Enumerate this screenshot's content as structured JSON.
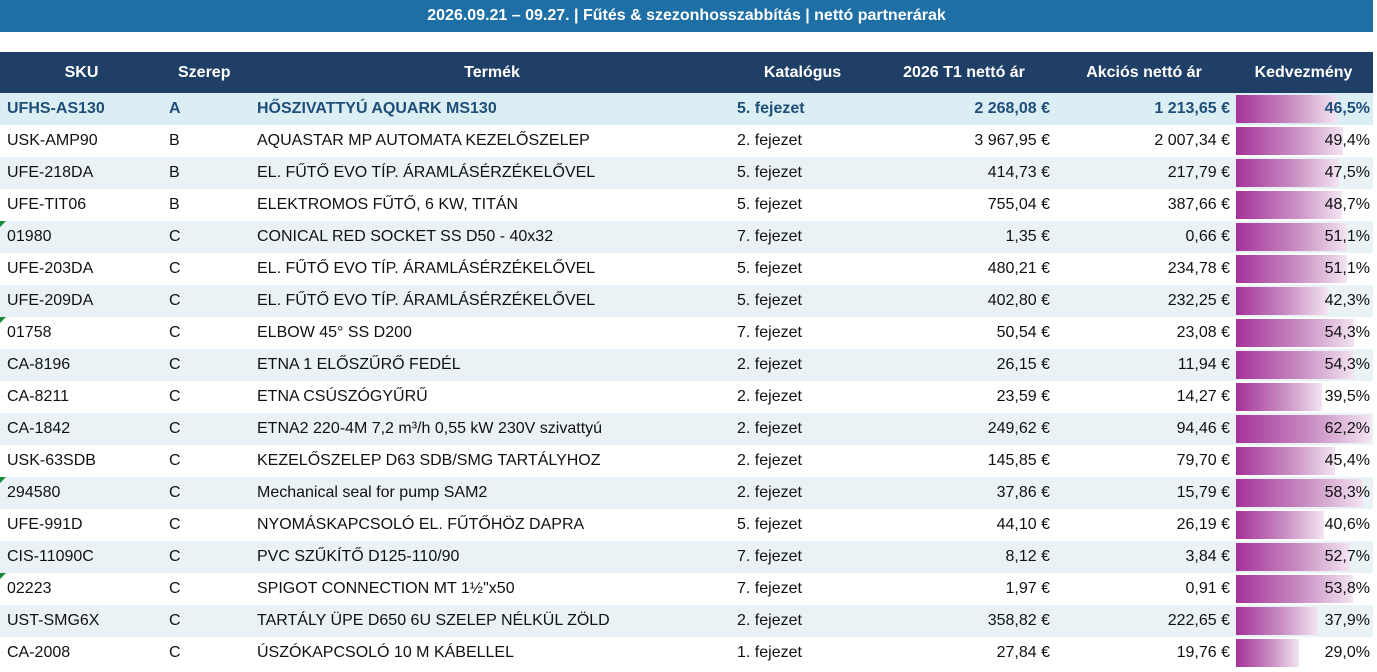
{
  "banner": {
    "text": "2026.09.21 – 09.27.  |  Fűtés & szezonhosszabbítás  |  nettó partnerárak"
  },
  "columns": {
    "sku": "SKU",
    "role": "Szerep",
    "product": "Termék",
    "catalog": "Katalógus",
    "list_price": "2026 T1 nettó ár",
    "promo_price": "Akciós nettó ár",
    "discount": "Kedvezmény"
  },
  "colors": {
    "banner_bg": "#1d6fa5",
    "header_bg": "#1f3f67",
    "highlight_text": "#1f4e79",
    "databar": "#a5329a",
    "comment_marker": "#1a8a3a"
  },
  "rows": [
    {
      "sku": "UFHS-AS130",
      "role": "A",
      "product": "HŐSZIVATTYÚ AQUARK MS130",
      "catalog": "5. fejezet",
      "list": "2 268,08 €",
      "promo": "1 213,65 €",
      "disc": "46,5%",
      "disc_value": 46.5,
      "marker": false
    },
    {
      "sku": "USK-AMP90",
      "role": "B",
      "product": "AQUASTAR MP AUTOMATA KEZELŐSZELEP",
      "catalog": "2. fejezet",
      "list": "3 967,95 €",
      "promo": "2 007,34 €",
      "disc": "49,4%",
      "disc_value": 49.4,
      "marker": false
    },
    {
      "sku": "UFE-218DA",
      "role": "B",
      "product": "EL. FŰTŐ EVO TÍP. ÁRAMLÁSÉRZÉKELŐVEL",
      "catalog": "5. fejezet",
      "list": "414,73 €",
      "promo": "217,79 €",
      "disc": "47,5%",
      "disc_value": 47.5,
      "marker": false
    },
    {
      "sku": "UFE-TIT06",
      "role": "B",
      "product": "ELEKTROMOS FŰTŐ, 6 KW, TITÁN",
      "catalog": "5. fejezet",
      "list": "755,04 €",
      "promo": "387,66 €",
      "disc": "48,7%",
      "disc_value": 48.7,
      "marker": false
    },
    {
      "sku": "01980",
      "role": "C",
      "product": "CONICAL RED SOCKET SS D50 - 40x32",
      "catalog": "7. fejezet",
      "list": "1,35 €",
      "promo": "0,66 €",
      "disc": "51,1%",
      "disc_value": 51.1,
      "marker": true
    },
    {
      "sku": "UFE-203DA",
      "role": "C",
      "product": "EL. FŰTŐ EVO TÍP. ÁRAMLÁSÉRZÉKELŐVEL",
      "catalog": "5. fejezet",
      "list": "480,21 €",
      "promo": "234,78 €",
      "disc": "51,1%",
      "disc_value": 51.1,
      "marker": false
    },
    {
      "sku": "UFE-209DA",
      "role": "C",
      "product": "EL. FŰTŐ EVO TÍP. ÁRAMLÁSÉRZÉKELŐVEL",
      "catalog": "5. fejezet",
      "list": "402,80 €",
      "promo": "232,25 €",
      "disc": "42,3%",
      "disc_value": 42.3,
      "marker": false
    },
    {
      "sku": "01758",
      "role": "C",
      "product": "ELBOW 45° SS D200",
      "catalog": "7. fejezet",
      "list": "50,54 €",
      "promo": "23,08 €",
      "disc": "54,3%",
      "disc_value": 54.3,
      "marker": true
    },
    {
      "sku": "CA-8196",
      "role": "C",
      "product": "ETNA 1 ELŐSZŰRŐ FEDÉL",
      "catalog": "2. fejezet",
      "list": "26,15 €",
      "promo": "11,94 €",
      "disc": "54,3%",
      "disc_value": 54.3,
      "marker": false
    },
    {
      "sku": "CA-8211",
      "role": "C",
      "product": "ETNA CSÚSZÓGYŰRŰ",
      "catalog": "2. fejezet",
      "list": "23,59 €",
      "promo": "14,27 €",
      "disc": "39,5%",
      "disc_value": 39.5,
      "marker": false
    },
    {
      "sku": "CA-1842",
      "role": "C",
      "product": "ETNA2 220-4M 7,2 m³/h 0,55 kW 230V szivattyú",
      "catalog": "2. fejezet",
      "list": "249,62 €",
      "promo": "94,46 €",
      "disc": "62,2%",
      "disc_value": 62.2,
      "marker": false
    },
    {
      "sku": "USK-63SDB",
      "role": "C",
      "product": "KEZELŐSZELEP D63 SDB/SMG TARTÁLYHOZ",
      "catalog": "2. fejezet",
      "list": "145,85 €",
      "promo": "79,70 €",
      "disc": "45,4%",
      "disc_value": 45.4,
      "marker": false
    },
    {
      "sku": "294580",
      "role": "C",
      "product": "Mechanical seal for pump SAM2",
      "catalog": "2. fejezet",
      "list": "37,86 €",
      "promo": "15,79 €",
      "disc": "58,3%",
      "disc_value": 58.3,
      "marker": true
    },
    {
      "sku": "UFE-991D",
      "role": "C",
      "product": "NYOMÁSKAPCSOLÓ EL. FŰTŐHÖZ DAPRA",
      "catalog": "5. fejezet",
      "list": "44,10 €",
      "promo": "26,19 €",
      "disc": "40,6%",
      "disc_value": 40.6,
      "marker": false
    },
    {
      "sku": "CIS-11090C",
      "role": "C",
      "product": "PVC SZŰKÍTŐ D125-110/90",
      "catalog": "7. fejezet",
      "list": "8,12 €",
      "promo": "3,84 €",
      "disc": "52,7%",
      "disc_value": 52.7,
      "marker": false
    },
    {
      "sku": "02223",
      "role": "C",
      "product": "SPIGOT CONNECTION MT 1½\"x50",
      "catalog": "7. fejezet",
      "list": "1,97 €",
      "promo": "0,91 €",
      "disc": "53,8%",
      "disc_value": 53.8,
      "marker": true
    },
    {
      "sku": "UST-SMG6X",
      "role": "C",
      "product": "TARTÁLY ÜPE D650 6U SZELEP NÉLKÜL ZÖLD",
      "catalog": "2. fejezet",
      "list": "358,82 €",
      "promo": "222,65 €",
      "disc": "37,9%",
      "disc_value": 37.9,
      "marker": false
    },
    {
      "sku": "CA-2008",
      "role": "C",
      "product": "ÚSZÓKAPCSOLÓ 10 M KÁBELLEL",
      "catalog": "1. fejezet",
      "list": "27,84 €",
      "promo": "19,76 €",
      "disc": "29,0%",
      "disc_value": 29.0,
      "marker": false
    }
  ]
}
